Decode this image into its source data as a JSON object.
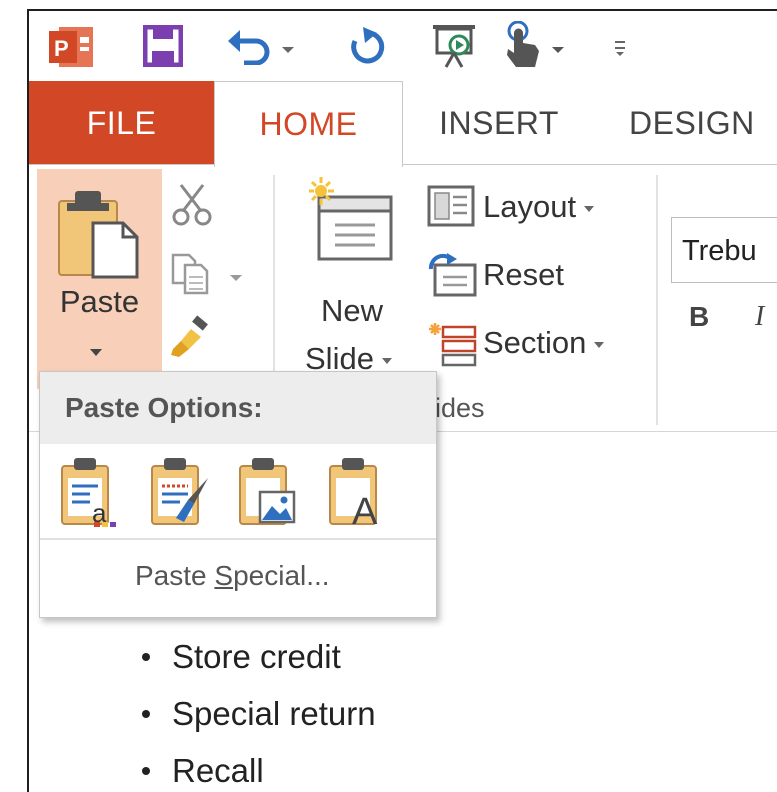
{
  "tabs": [
    {
      "label": "FILE"
    },
    {
      "label": "HOME"
    },
    {
      "label": "INSERT"
    },
    {
      "label": "DESIGN"
    }
  ],
  "ribbon": {
    "paste_label": "Paste",
    "new_slide_line1": "New",
    "new_slide_line2": "Slide",
    "layout_label": "Layout",
    "reset_label": "Reset",
    "section_label": "Section",
    "slides_group_label": "lides",
    "font_name": "Trebu",
    "bold_label": "B",
    "italic_label": "I"
  },
  "paste_options": {
    "title": "Paste Options:",
    "special_prefix": "Paste ",
    "special_underlined": "S",
    "special_suffix": "pecial..."
  },
  "slide": {
    "bullets": [
      "Store credit",
      "Special return",
      "Recall"
    ]
  },
  "colors": {
    "accent": "#d24726",
    "paste_highlight": "#f8cfb8",
    "save_purple": "#7b3fb0",
    "undo_blue": "#2f6fbf"
  },
  "icons": [
    "powerpoint-logo-icon",
    "save-icon",
    "undo-icon",
    "redo-icon",
    "slideshow-icon",
    "touch-mode-icon",
    "customize-qat-icon"
  ]
}
